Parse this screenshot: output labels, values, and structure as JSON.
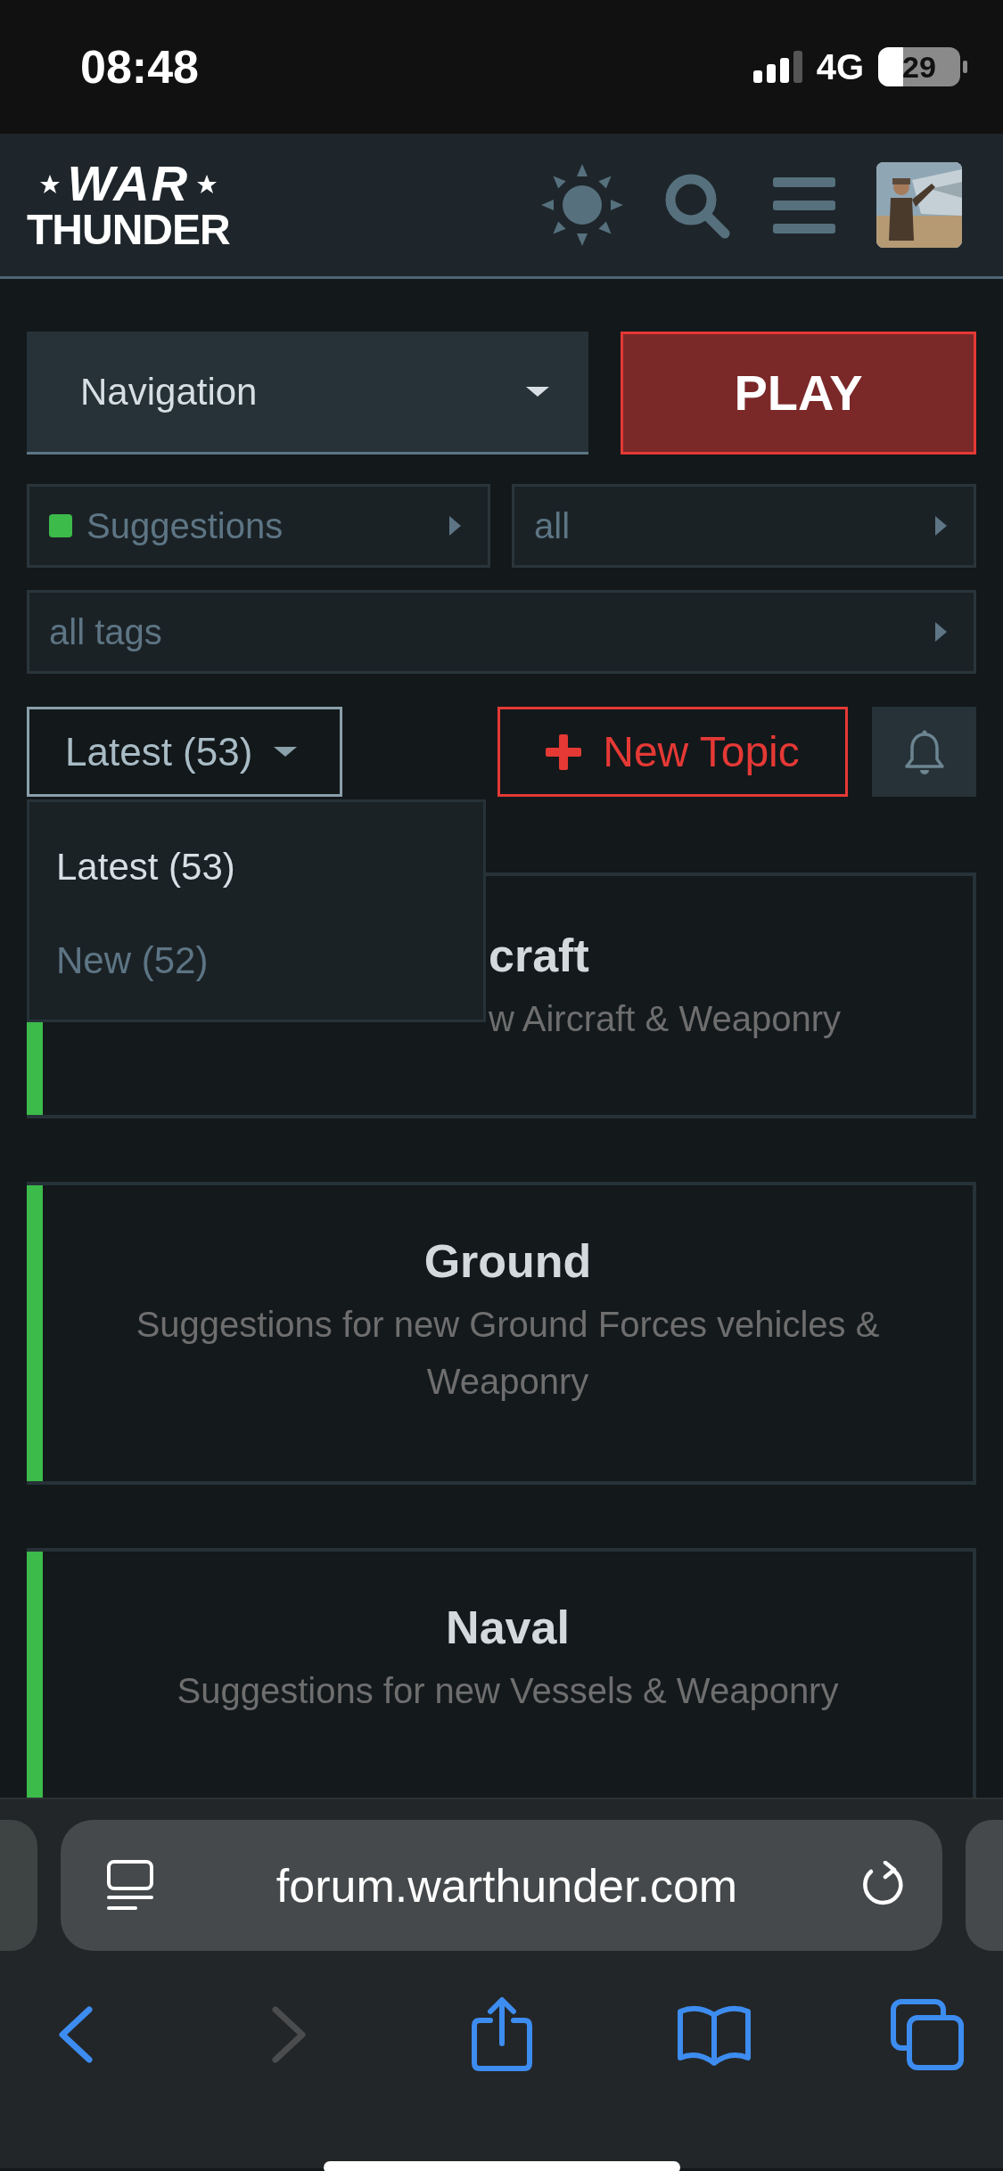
{
  "status_bar": {
    "time": "08:48",
    "network": "4G",
    "battery": "29"
  },
  "header": {
    "logo": [
      "WAR",
      "THUNDER"
    ],
    "avatar": {
      "kind": "picture"
    }
  },
  "navigation": {
    "label": "Navigation"
  },
  "play_button": "PLAY",
  "filters": [
    {
      "label": "Suggestions",
      "color": "#3cba4a"
    },
    {
      "label": "all"
    },
    {
      "label": "all tags"
    }
  ],
  "sort": {
    "label": "Latest (53)",
    "expanded": true,
    "options": [
      {
        "label": "Latest (53)",
        "selected": true
      },
      {
        "label": "New (52)",
        "selected": false
      }
    ]
  },
  "new_topic": "New Topic",
  "categories": [
    {
      "title": "craft",
      "description": "w Aircraft & Weaponry",
      "color": "#3cba4a"
    },
    {
      "title": "Ground",
      "description": "Suggestions for new Ground Forces vehicles & Weaponry",
      "color": "#3cba4a"
    },
    {
      "title": "Naval",
      "description": "Suggestions for new Vessels & Weaponry",
      "color": "#3cba4a"
    }
  ],
  "browser": {
    "url": "forum.warthunder.com",
    "forward_disabled": true
  }
}
